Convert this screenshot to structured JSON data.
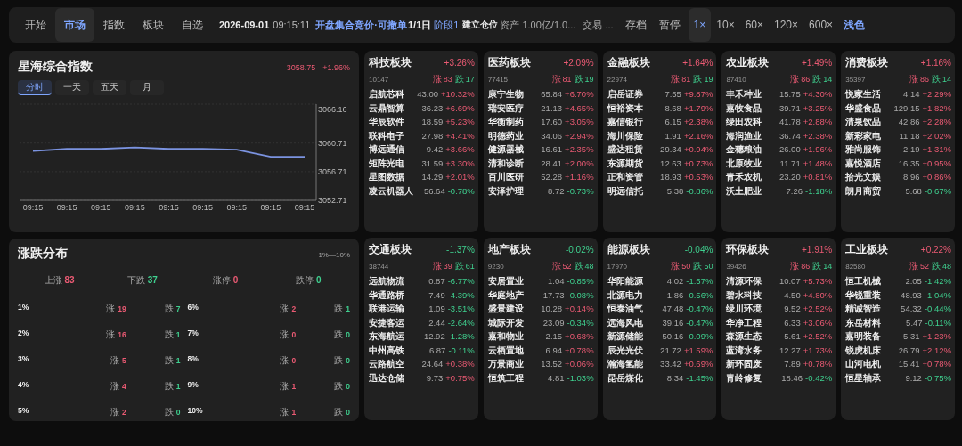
{
  "top_bar": {
    "tabs": [
      {
        "label": "开始",
        "selected": false
      },
      {
        "label": "市场",
        "selected": true
      },
      {
        "label": "指数",
        "selected": false
      },
      {
        "label": "板块",
        "selected": false
      },
      {
        "label": "自选",
        "selected": false
      }
    ],
    "date": "2026-09-01",
    "time": "09:15:11",
    "phase": "开盘集合竞价·可撤单",
    "day": "1/1日",
    "stage": "阶段1",
    "action": "建立仓位",
    "assets": "资产 1.00亿/1.0...",
    "trade": "交易 ...",
    "buttons": [
      "存档",
      "暂停"
    ],
    "speeds": [
      {
        "label": "1×",
        "selected": true
      },
      {
        "label": "10×",
        "selected": false
      },
      {
        "label": "60×",
        "selected": false
      },
      {
        "label": "120×",
        "selected": false
      },
      {
        "label": "600×",
        "selected": false
      }
    ],
    "theme_toggle": "浅色"
  },
  "index_panel": {
    "title": "星海综合指数",
    "value": "3058.75",
    "change": "+1.96%",
    "ranges": [
      {
        "label": "分时",
        "selected": true
      },
      {
        "label": "一天",
        "selected": false
      },
      {
        "label": "五天",
        "selected": false
      },
      {
        "label": "月",
        "selected": false
      }
    ],
    "chart_data": {
      "type": "line",
      "categories": [
        "09:15",
        "09:15",
        "09:15",
        "09:15",
        "09:15",
        "09:15",
        "09:15",
        "09:15",
        "09:15"
      ],
      "series": [
        {
          "color": "#7b93e0",
          "values": [
            3059.6,
            3059.9,
            3059.9,
            3060.1,
            3059.9,
            3059.9,
            3059.8,
            3058.8,
            3058.8
          ]
        }
      ],
      "ylim": [
        3052.71,
        3066.16
      ],
      "yticks": [
        3052.71,
        3056.71,
        3060.71,
        3066.16
      ]
    }
  },
  "distribution": {
    "title": "涨跌分布",
    "range": "1%—10%",
    "summary": [
      {
        "label": "上涨",
        "count": "83",
        "rising": true
      },
      {
        "label": "下跌",
        "count": "37",
        "rising": false
      },
      {
        "label": "涨停",
        "count": "0",
        "rising": true
      },
      {
        "label": "跌停",
        "count": "0",
        "rising": false
      }
    ],
    "rows": [
      {
        "level": "1%",
        "up_label": "涨",
        "up": "19",
        "down_label": "跌",
        "down": "7"
      },
      {
        "level": "2%",
        "up_label": "涨",
        "up": "16",
        "down_label": "跌",
        "down": "1"
      },
      {
        "level": "3%",
        "up_label": "涨",
        "up": "5",
        "down_label": "跌",
        "down": "1"
      },
      {
        "level": "4%",
        "up_label": "涨",
        "up": "4",
        "down_label": "跌",
        "down": "1"
      },
      {
        "level": "5%",
        "up_label": "涨",
        "up": "2",
        "down_label": "跌",
        "down": "0"
      },
      {
        "level": "6%",
        "up_label": "涨",
        "up": "2",
        "down_label": "跌",
        "down": "1"
      },
      {
        "level": "7%",
        "up_label": "涨",
        "up": "0",
        "down_label": "跌",
        "down": "0"
      },
      {
        "level": "8%",
        "up_label": "涨",
        "up": "0",
        "down_label": "跌",
        "down": "0"
      },
      {
        "level": "9%",
        "up_label": "涨",
        "up": "1",
        "down_label": "跌",
        "down": "0"
      },
      {
        "level": "10%",
        "up_label": "涨",
        "up": "1",
        "down_label": "跌",
        "down": "0"
      }
    ]
  },
  "sectors": [
    {
      "name": "科技板块",
      "change": "+3.26%",
      "rising": true,
      "code": "10147",
      "up_label": "涨",
      "up": "83",
      "down_label": "跌",
      "down": "17",
      "stocks": [
        {
          "name": "启航芯科",
          "price": "43.00",
          "change": "+10.32%",
          "rising": true
        },
        {
          "name": "云鼎智算",
          "price": "36.23",
          "change": "+6.69%",
          "rising": true
        },
        {
          "name": "华辰软件",
          "price": "18.59",
          "change": "+5.23%",
          "rising": true
        },
        {
          "name": "联科电子",
          "price": "27.98",
          "change": "+4.41%",
          "rising": true
        },
        {
          "name": "博远通信",
          "price": "9.42",
          "change": "+3.66%",
          "rising": true
        },
        {
          "name": "矩阵光电",
          "price": "31.59",
          "change": "+3.30%",
          "rising": true
        },
        {
          "name": "星图数据",
          "price": "14.29",
          "change": "+2.01%",
          "rising": true
        },
        {
          "name": "凌云机器人",
          "price": "56.64",
          "change": "-0.78%",
          "rising": false
        }
      ]
    },
    {
      "name": "医药板块",
      "change": "+2.09%",
      "rising": true,
      "code": "77415",
      "up_label": "涨",
      "up": "81",
      "down_label": "跌",
      "down": "19",
      "stocks": [
        {
          "name": "康宁生物",
          "price": "65.84",
          "change": "+6.70%",
          "rising": true
        },
        {
          "name": "瑞安医疗",
          "price": "21.13",
          "change": "+4.65%",
          "rising": true
        },
        {
          "name": "华衡制药",
          "price": "17.60",
          "change": "+3.05%",
          "rising": true
        },
        {
          "name": "明德药业",
          "price": "34.06",
          "change": "+2.94%",
          "rising": true
        },
        {
          "name": "健源器械",
          "price": "16.61",
          "change": "+2.35%",
          "rising": true
        },
        {
          "name": "清和诊断",
          "price": "28.41",
          "change": "+2.00%",
          "rising": true
        },
        {
          "name": "百川医研",
          "price": "52.28",
          "change": "+1.16%",
          "rising": true
        },
        {
          "name": "安泽护理",
          "price": "8.72",
          "change": "-0.73%",
          "rising": false
        }
      ]
    },
    {
      "name": "金融板块",
      "change": "+1.64%",
      "rising": true,
      "code": "22974",
      "up_label": "涨",
      "up": "81",
      "down_label": "跌",
      "down": "19",
      "stocks": [
        {
          "name": "启岳证券",
          "price": "7.55",
          "change": "+9.87%",
          "rising": true
        },
        {
          "name": "恒裕资本",
          "price": "8.68",
          "change": "+1.79%",
          "rising": true
        },
        {
          "name": "嘉信银行",
          "price": "6.15",
          "change": "+2.38%",
          "rising": true
        },
        {
          "name": "海川保险",
          "price": "1.91",
          "change": "+2.16%",
          "rising": true
        },
        {
          "name": "盛达租赁",
          "price": "29.34",
          "change": "+0.94%",
          "rising": true
        },
        {
          "name": "东源期货",
          "price": "12.63",
          "change": "+0.73%",
          "rising": true
        },
        {
          "name": "正和资管",
          "price": "18.93",
          "change": "+0.53%",
          "rising": true
        },
        {
          "name": "明远信托",
          "price": "5.38",
          "change": "-0.86%",
          "rising": false
        }
      ]
    },
    {
      "name": "农业板块",
      "change": "+1.49%",
      "rising": true,
      "code": "87410",
      "up_label": "涨",
      "up": "86",
      "down_label": "跌",
      "down": "14",
      "stocks": [
        {
          "name": "丰禾种业",
          "price": "15.75",
          "change": "+4.30%",
          "rising": true
        },
        {
          "name": "嘉牧食品",
          "price": "39.71",
          "change": "+3.25%",
          "rising": true
        },
        {
          "name": "绿田农科",
          "price": "41.78",
          "change": "+2.88%",
          "rising": true
        },
        {
          "name": "海润渔业",
          "price": "36.74",
          "change": "+2.38%",
          "rising": true
        },
        {
          "name": "金穗粮油",
          "price": "26.00",
          "change": "+1.96%",
          "rising": true
        },
        {
          "name": "北原牧业",
          "price": "11.71",
          "change": "+1.48%",
          "rising": true
        },
        {
          "name": "青禾农机",
          "price": "23.20",
          "change": "+0.81%",
          "rising": true
        },
        {
          "name": "沃土肥业",
          "price": "7.26",
          "change": "-1.18%",
          "rising": false
        }
      ]
    },
    {
      "name": "消费板块",
      "change": "+1.16%",
      "rising": true,
      "code": "35397",
      "up_label": "涨",
      "up": "86",
      "down_label": "跌",
      "down": "14",
      "stocks": [
        {
          "name": "悦家生活",
          "price": "4.14",
          "change": "+2.29%",
          "rising": true
        },
        {
          "name": "华盛食品",
          "price": "129.15",
          "change": "+1.82%",
          "rising": true
        },
        {
          "name": "清泉饮品",
          "price": "42.86",
          "change": "+2.28%",
          "rising": true
        },
        {
          "name": "新彩家电",
          "price": "11.18",
          "change": "+2.02%",
          "rising": true
        },
        {
          "name": "雅尚服饰",
          "price": "2.19",
          "change": "+1.31%",
          "rising": true
        },
        {
          "name": "嘉悦酒店",
          "price": "16.35",
          "change": "+0.95%",
          "rising": true
        },
        {
          "name": "拾光文娱",
          "price": "8.96",
          "change": "+0.86%",
          "rising": true
        },
        {
          "name": "朗月商贸",
          "price": "5.68",
          "change": "-0.67%",
          "rising": false
        }
      ]
    },
    {
      "name": "交通板块",
      "change": "-1.37%",
      "rising": false,
      "code": "38744",
      "up_label": "涨",
      "up": "39",
      "down_label": "跌",
      "down": "61",
      "stocks": [
        {
          "name": "远航物流",
          "price": "0.87",
          "change": "-6.77%",
          "rising": false
        },
        {
          "name": "华通路桥",
          "price": "7.49",
          "change": "-4.39%",
          "rising": false
        },
        {
          "name": "联港运输",
          "price": "1.09",
          "change": "-3.51%",
          "rising": false
        },
        {
          "name": "安捷客运",
          "price": "2.44",
          "change": "-2.64%",
          "rising": false
        },
        {
          "name": "东海航运",
          "price": "12.92",
          "change": "-1.28%",
          "rising": false
        },
        {
          "name": "中州高铁",
          "price": "6.87",
          "change": "-0.11%",
          "rising": false
        },
        {
          "name": "云路航空",
          "price": "24.64",
          "change": "+0.38%",
          "rising": true
        },
        {
          "name": "迅达仓储",
          "price": "9.73",
          "change": "+0.75%",
          "rising": true
        }
      ]
    },
    {
      "name": "地产板块",
      "change": "-0.02%",
      "rising": false,
      "code": "9230",
      "up_label": "涨",
      "up": "52",
      "down_label": "跌",
      "down": "48",
      "stocks": [
        {
          "name": "安居置业",
          "price": "1.04",
          "change": "-0.85%",
          "rising": false
        },
        {
          "name": "华庭地产",
          "price": "17.73",
          "change": "-0.08%",
          "rising": false
        },
        {
          "name": "盛景建设",
          "price": "10.28",
          "change": "+0.14%",
          "rising": true
        },
        {
          "name": "城际开发",
          "price": "23.09",
          "change": "-0.34%",
          "rising": false
        },
        {
          "name": "嘉和物业",
          "price": "2.15",
          "change": "+0.68%",
          "rising": true
        },
        {
          "name": "云栖置地",
          "price": "6.94",
          "change": "+0.78%",
          "rising": true
        },
        {
          "name": "万景商业",
          "price": "13.52",
          "change": "+0.06%",
          "rising": true
        },
        {
          "name": "恒筑工程",
          "price": "4.81",
          "change": "-1.03%",
          "rising": false
        }
      ]
    },
    {
      "name": "能源板块",
      "change": "-0.04%",
      "rising": false,
      "code": "17970",
      "up_label": "涨",
      "up": "50",
      "down_label": "跌",
      "down": "50",
      "stocks": [
        {
          "name": "华阳能源",
          "price": "4.02",
          "change": "-1.57%",
          "rising": false
        },
        {
          "name": "北源电力",
          "price": "1.86",
          "change": "-0.56%",
          "rising": false
        },
        {
          "name": "恒泰油气",
          "price": "47.48",
          "change": "-0.47%",
          "rising": false
        },
        {
          "name": "远海风电",
          "price": "39.16",
          "change": "-0.47%",
          "rising": false
        },
        {
          "name": "新源储能",
          "price": "50.16",
          "change": "-0.09%",
          "rising": false
        },
        {
          "name": "辰光光伏",
          "price": "21.72",
          "change": "+1.59%",
          "rising": true
        },
        {
          "name": "瀚海氢能",
          "price": "33.42",
          "change": "+0.69%",
          "rising": true
        },
        {
          "name": "昆岳煤化",
          "price": "8.34",
          "change": "-1.45%",
          "rising": false
        }
      ]
    },
    {
      "name": "环保板块",
      "change": "+1.91%",
      "rising": true,
      "code": "39426",
      "up_label": "涨",
      "up": "86",
      "down_label": "跌",
      "down": "14",
      "stocks": [
        {
          "name": "清源环保",
          "price": "10.07",
          "change": "+5.73%",
          "rising": true
        },
        {
          "name": "碧水科技",
          "price": "4.50",
          "change": "+4.80%",
          "rising": true
        },
        {
          "name": "绿川环境",
          "price": "9.52",
          "change": "+2.52%",
          "rising": true
        },
        {
          "name": "华净工程",
          "price": "6.33",
          "change": "+3.06%",
          "rising": true
        },
        {
          "name": "森源生态",
          "price": "5.61",
          "change": "+2.52%",
          "rising": true
        },
        {
          "name": "蓝湾水务",
          "price": "12.27",
          "change": "+1.73%",
          "rising": true
        },
        {
          "name": "新环固废",
          "price": "7.89",
          "change": "+0.78%",
          "rising": true
        },
        {
          "name": "青岭修复",
          "price": "18.46",
          "change": "-0.42%",
          "rising": false
        }
      ]
    },
    {
      "name": "工业板块",
      "change": "+0.22%",
      "rising": true,
      "code": "82580",
      "up_label": "涨",
      "up": "52",
      "down_label": "跌",
      "down": "48",
      "stocks": [
        {
          "name": "恒工机械",
          "price": "2.05",
          "change": "-1.42%",
          "rising": false
        },
        {
          "name": "华锐重装",
          "price": "48.93",
          "change": "-1.04%",
          "rising": false
        },
        {
          "name": "精诚智造",
          "price": "54.32",
          "change": "-0.44%",
          "rising": false
        },
        {
          "name": "东岳材料",
          "price": "5.47",
          "change": "-0.11%",
          "rising": false
        },
        {
          "name": "嘉明装备",
          "price": "5.31",
          "change": "+1.23%",
          "rising": true
        },
        {
          "name": "锐虎机床",
          "price": "26.79",
          "change": "+2.12%",
          "rising": true
        },
        {
          "name": "山河电机",
          "price": "15.41",
          "change": "+0.78%",
          "rising": true
        },
        {
          "name": "恒星轴承",
          "price": "9.12",
          "change": "-0.75%",
          "rising": false
        }
      ]
    }
  ]
}
